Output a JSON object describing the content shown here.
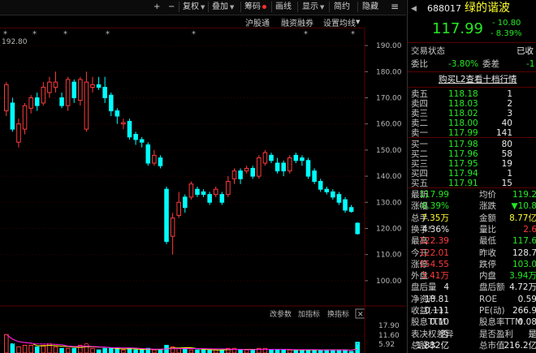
{
  "toolbar": {
    "plus": "+",
    "minus": "−",
    "fuquan": "复权",
    "diejia": "叠加",
    "chouma": "筹码",
    "huaxian": "画线",
    "xianshi": "显示",
    "jungou": "简约",
    "yincang": "隐藏",
    "menu": "≡"
  },
  "toolbar2": {
    "hugutong": "沪股通",
    "rongzi": "融资融券",
    "shezhi": "设置均线",
    "chart_stars": [
      "*",
      "*",
      "*",
      "*",
      "*",
      "*",
      "*"
    ]
  },
  "chart_labels": {
    "high_marker": "192.80"
  },
  "indicator_bar": {
    "gai_canshu": "改参数",
    "jia_zhibiao": "加指标",
    "huan_zhibiao": "换指标",
    "close": "✕"
  },
  "colors": {
    "up": "#ff3b3b",
    "down": "#00ffff",
    "ma5": "#ffffff",
    "ma10": "#ffff00",
    "ma20": "#ff00ff",
    "vol_ma": "#ffff00"
  },
  "chart_data": {
    "type": "candlestick",
    "price_axis": {
      "ticks": [
        190,
        180,
        170,
        160,
        150,
        140,
        130,
        120,
        110,
        100
      ],
      "labels": [
        "190.00",
        "180.00",
        "170.00",
        "160.00",
        "150.00",
        "140.00",
        "130.00",
        "120.00",
        "110.00",
        "100.00"
      ],
      "range": [
        95,
        195
      ]
    },
    "volume_axis": {
      "labels": [
        "17.90",
        "11.60",
        "5.92"
      ],
      "ticks": [
        17.9,
        11.6,
        5.92
      ],
      "range": [
        0,
        20
      ]
    },
    "candles": [
      {
        "o": 165,
        "c": 175,
        "h": 176,
        "l": 163,
        "v": 12
      },
      {
        "o": 168,
        "c": 158,
        "h": 170,
        "l": 157,
        "v": 6
      },
      {
        "o": 153,
        "c": 160,
        "h": 162,
        "l": 151,
        "v": 4
      },
      {
        "o": 158,
        "c": 167,
        "h": 168,
        "l": 156,
        "v": 5
      },
      {
        "o": 166,
        "c": 170,
        "h": 171,
        "l": 164,
        "v": 5
      },
      {
        "o": 170,
        "c": 167,
        "h": 172,
        "l": 165,
        "v": 4
      },
      {
        "o": 168,
        "c": 174,
        "h": 176,
        "l": 167,
        "v": 5
      },
      {
        "o": 172,
        "c": 176,
        "h": 178,
        "l": 170,
        "v": 6
      },
      {
        "o": 174,
        "c": 176,
        "h": 180,
        "l": 172,
        "v": 4
      },
      {
        "o": 170,
        "c": 167,
        "h": 172,
        "l": 166,
        "v": 3
      },
      {
        "o": 167,
        "c": 177,
        "h": 178,
        "l": 165,
        "v": 3
      },
      {
        "o": 176,
        "c": 170,
        "h": 177,
        "l": 168,
        "v": 3
      },
      {
        "o": 169,
        "c": 177,
        "h": 178,
        "l": 167,
        "v": 5
      },
      {
        "o": 158,
        "c": 176,
        "h": 180,
        "l": 157,
        "v": 6
      },
      {
        "o": 174,
        "c": 175,
        "h": 178,
        "l": 172,
        "v": 3
      },
      {
        "o": 175,
        "c": 174,
        "h": 178,
        "l": 173,
        "v": 2
      },
      {
        "o": 174,
        "c": 170,
        "h": 178,
        "l": 168,
        "v": 3
      },
      {
        "o": 171,
        "c": 165,
        "h": 172,
        "l": 163,
        "v": 3
      },
      {
        "o": 165,
        "c": 163,
        "h": 166,
        "l": 160,
        "v": 3
      },
      {
        "o": 160,
        "c": 160.5,
        "h": 162,
        "l": 158,
        "v": 2
      },
      {
        "o": 161,
        "c": 155,
        "h": 162,
        "l": 154,
        "v": 3
      },
      {
        "o": 156,
        "c": 154,
        "h": 157,
        "l": 152,
        "v": 2
      },
      {
        "o": 154,
        "c": 153,
        "h": 155,
        "l": 151,
        "v": 2
      },
      {
        "o": 152,
        "c": 145,
        "h": 153,
        "l": 144,
        "v": 3
      },
      {
        "o": 145,
        "c": 148,
        "h": 150,
        "l": 144,
        "v": 2
      },
      {
        "o": 147,
        "c": 144,
        "h": 148,
        "l": 143,
        "v": 2
      },
      {
        "o": 135,
        "c": 115,
        "h": 136,
        "l": 114,
        "v": 5
      },
      {
        "o": 117,
        "c": 124,
        "h": 126,
        "l": 110,
        "v": 4
      },
      {
        "o": 125,
        "c": 130,
        "h": 134,
        "l": 124,
        "v": 3
      },
      {
        "o": 132,
        "c": 128,
        "h": 133,
        "l": 126,
        "v": 3
      },
      {
        "o": 132,
        "c": 137,
        "h": 138,
        "l": 131,
        "v": 2
      },
      {
        "o": 135,
        "c": 133,
        "h": 136,
        "l": 132,
        "v": 2
      },
      {
        "o": 134,
        "c": 133,
        "h": 135,
        "l": 132,
        "v": 2
      },
      {
        "o": 133,
        "c": 130,
        "h": 134,
        "l": 129,
        "v": 2
      },
      {
        "o": 133,
        "c": 135,
        "h": 136,
        "l": 132,
        "v": 2
      },
      {
        "o": 133,
        "c": 130,
        "h": 134,
        "l": 129,
        "v": 2
      },
      {
        "o": 133,
        "c": 138,
        "h": 140,
        "l": 132,
        "v": 3
      },
      {
        "o": 139,
        "c": 142,
        "h": 143,
        "l": 137,
        "v": 3
      },
      {
        "o": 142,
        "c": 139,
        "h": 143,
        "l": 137,
        "v": 2
      },
      {
        "o": 142,
        "c": 143,
        "h": 144,
        "l": 141,
        "v": 2
      },
      {
        "o": 143,
        "c": 140,
        "h": 144,
        "l": 139,
        "v": 2
      },
      {
        "o": 140,
        "c": 147,
        "h": 148,
        "l": 139,
        "v": 3
      },
      {
        "o": 145,
        "c": 149,
        "h": 150,
        "l": 144,
        "v": 3
      },
      {
        "o": 148,
        "c": 146,
        "h": 149,
        "l": 145,
        "v": 2
      },
      {
        "o": 145,
        "c": 142,
        "h": 147,
        "l": 141,
        "v": 2
      },
      {
        "o": 145,
        "c": 142,
        "h": 146,
        "l": 140,
        "v": 2
      },
      {
        "o": 142,
        "c": 147,
        "h": 148,
        "l": 141,
        "v": 2
      },
      {
        "o": 148,
        "c": 146,
        "h": 149,
        "l": 145,
        "v": 2
      },
      {
        "o": 147,
        "c": 146,
        "h": 148,
        "l": 144,
        "v": 2
      },
      {
        "o": 146,
        "c": 140,
        "h": 147,
        "l": 139,
        "v": 2
      },
      {
        "o": 142,
        "c": 138,
        "h": 143,
        "l": 137,
        "v": 2
      },
      {
        "o": 138,
        "c": 135,
        "h": 139,
        "l": 134,
        "v": 2
      },
      {
        "o": 135,
        "c": 134,
        "h": 136,
        "l": 133,
        "v": 2
      },
      {
        "o": 134,
        "c": 132,
        "h": 135,
        "l": 131,
        "v": 2
      },
      {
        "o": 133,
        "c": 130,
        "h": 134,
        "l": 129,
        "v": 2
      },
      {
        "o": 131,
        "c": 127,
        "h": 132,
        "l": 126,
        "v": 2
      },
      {
        "o": 128,
        "c": 126.5,
        "h": 129,
        "l": 126,
        "v": 1
      },
      {
        "o": 122,
        "c": 117.99,
        "h": 122.39,
        "l": 117.64,
        "v": 7
      }
    ]
  },
  "stock": {
    "code": "688017",
    "name": "绿的谐波",
    "price": "117.99",
    "change": "- 10.80",
    "change_pct": "- 8.39%",
    "status_label": "交易状态",
    "status_value": "已收",
    "weibi_label": "委比",
    "weibi_value": "-3.80%",
    "weicha_label": "委差",
    "weicha_value": "-1",
    "l2_link": "购买L2查看十档行情"
  },
  "orderbook": {
    "asks": [
      {
        "label": "卖五",
        "price": "118.18",
        "vol": "1"
      },
      {
        "label": "卖四",
        "price": "118.03",
        "vol": "2"
      },
      {
        "label": "卖三",
        "price": "118.02",
        "vol": "3"
      },
      {
        "label": "卖二",
        "price": "118.00",
        "vol": "40"
      },
      {
        "label": "卖一",
        "price": "117.99",
        "vol": "141"
      }
    ],
    "bids": [
      {
        "label": "买一",
        "price": "117.98",
        "vol": "80"
      },
      {
        "label": "买二",
        "price": "117.96",
        "vol": "58"
      },
      {
        "label": "买三",
        "price": "117.95",
        "vol": "19"
      },
      {
        "label": "买四",
        "price": "117.94",
        "vol": "1"
      },
      {
        "label": "买五",
        "price": "117.91",
        "vol": "15"
      }
    ]
  },
  "quotes": [
    {
      "l1": "最新",
      "v1": "117.99",
      "l2": "均价",
      "v2": "119.2"
    },
    {
      "l1": "涨幅",
      "v1": "-8.39%",
      "l2": "涨跌",
      "v2": "▼10.8"
    },
    {
      "l1": "总手",
      "v1": "7.35万",
      "l2": "金额",
      "v2": "8.77亿"
    },
    {
      "l1": "换手*",
      "v1": "4.36%",
      "l2": "量比",
      "v2": "2.6"
    },
    {
      "l1": "最高",
      "v1": "122.39",
      "l2": "最低",
      "v2": "117.6"
    },
    {
      "l1": "今开",
      "v1": "122.01",
      "l2": "昨收",
      "v2": "128.7"
    },
    {
      "l1": "涨停",
      "v1": "154.55",
      "l2": "跌停",
      "v2": "103.0"
    },
    {
      "l1": "外盘",
      "v1": "3.41万",
      "l2": "内盘",
      "v2": "3.94万"
    },
    {
      "l1": "盘后量",
      "v1": "4",
      "l2": "盘后额",
      "v2": "4.72万"
    },
    {
      "l1": "净资产",
      "v1": "18.81",
      "l2": "ROE",
      "v2": "0.59"
    },
    {
      "l1": "收益(一)",
      "v1": "0.111",
      "l2": "PE(动)",
      "v2": "266.9"
    },
    {
      "l1": "股息TTM",
      "v1": "0.10",
      "l2": "股息率TTM",
      "v2": "0.08"
    },
    {
      "l1": "表决权差异",
      "v1": "否",
      "l2": "是否盈利",
      "v2": "是"
    },
    {
      "l1": "总股本",
      "v1": "1.832亿",
      "l2": "总市值",
      "v2": "216.2亿"
    }
  ]
}
